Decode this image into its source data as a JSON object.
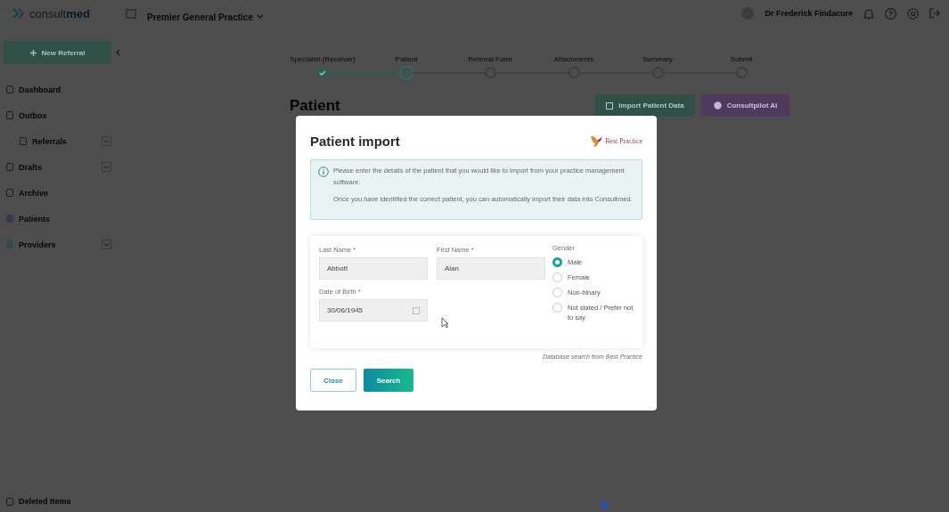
{
  "header": {
    "logo": "consult**med**",
    "practice": "Premier General Practice",
    "user": "Dr Frederick Findacure"
  },
  "sidebar": {
    "new_button": "New Referral",
    "items": [
      {
        "label": "Dashboard",
        "kind": "home",
        "expandable": false
      },
      {
        "label": "Outbox",
        "kind": "outbox",
        "expandable": false,
        "children": [
          {
            "label": "Referrals",
            "kind": "doc",
            "expandable": true
          }
        ]
      },
      {
        "label": "Drafts",
        "kind": "drafts",
        "expandable": true
      },
      {
        "label": "Archive",
        "kind": "archive",
        "expandable": false
      },
      {
        "label": "Patients",
        "kind": "patients",
        "expandable": false
      },
      {
        "label": "Providers",
        "kind": "providers",
        "expandable": true
      }
    ],
    "footer_item": "Deleted Items"
  },
  "steps": [
    {
      "label": "Specialist (Receiver)",
      "completed": true,
      "selected": false
    },
    {
      "label": "Patient",
      "completed": false,
      "selected": true
    },
    {
      "label": "Referral Form",
      "completed": false,
      "selected": false
    },
    {
      "label": "Attachments",
      "completed": false,
      "selected": false
    },
    {
      "label": "Summary",
      "completed": false,
      "selected": false
    },
    {
      "label": "Submit",
      "completed": false,
      "selected": false
    }
  ],
  "page": {
    "heading": "Patient",
    "import_button": "Import Patient Data",
    "ai_button": "Consultpilot AI"
  },
  "dialog": {
    "title": "Patient import",
    "brand": "Best Practice",
    "info": [
      "Please enter the details of the patient that you would like to import from your practice management software.",
      "Once you have identified the correct patient, you can automatically import their data into Consultmed."
    ],
    "fields": [
      {
        "label": "Last Name *",
        "value": "Abbott",
        "kind": "text"
      },
      {
        "label": "First Name *",
        "value": "Alan",
        "kind": "text"
      },
      {
        "label": "Date of Birth *",
        "value": "30/06/1945",
        "kind": "date"
      }
    ],
    "gender": {
      "label": "Gender",
      "options": [
        {
          "label": "Male",
          "selected": true
        },
        {
          "label": "Female",
          "selected": false
        },
        {
          "label": "Non-binary",
          "selected": false
        },
        {
          "label": "Not stated / Prefer not to say",
          "selected": false
        }
      ]
    },
    "note": "Database search from Best Practice",
    "buttons": [
      {
        "label": "Close",
        "kind": "secondary"
      },
      {
        "label": "Search",
        "kind": "primary"
      }
    ]
  }
}
